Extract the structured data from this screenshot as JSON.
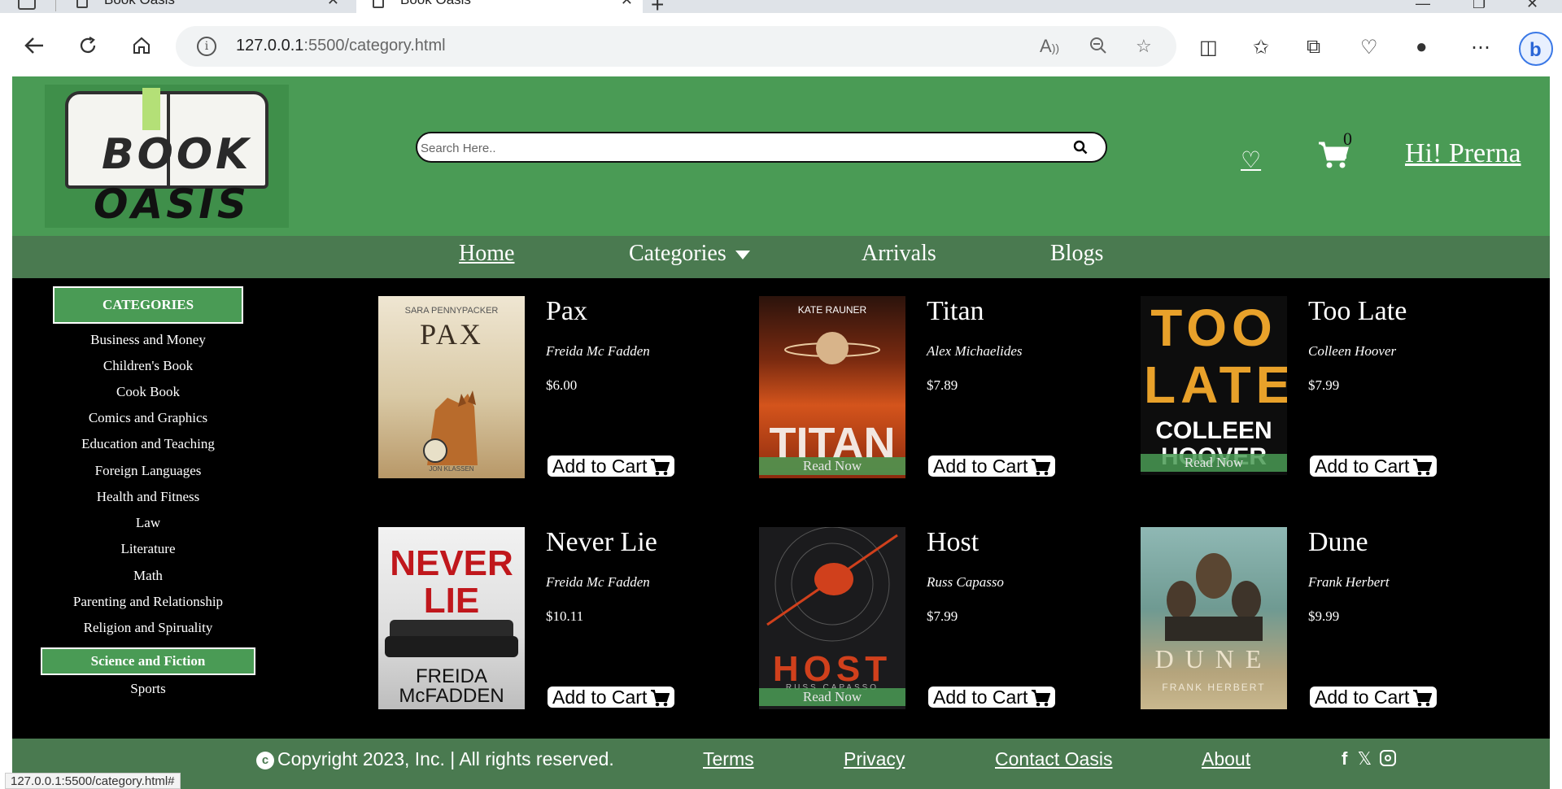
{
  "browser": {
    "tabs": [
      {
        "title": "Book Oasis",
        "active": false
      },
      {
        "title": "Book Oasis",
        "active": true
      }
    ],
    "url_host": "127.0.0.1",
    "url_path": ":5500/category.html",
    "status_url": "127.0.0.1:5500/category.html#"
  },
  "header": {
    "logo_line1": "BOOK",
    "logo_line2": "OASIS",
    "search_placeholder": "Search Here..",
    "cart_count": "0",
    "greeting": "Hi! Prerna"
  },
  "nav": {
    "home": "Home",
    "categories": "Categories",
    "arrivals": "Arrivals",
    "blogs": "Blogs"
  },
  "sidebar": {
    "heading": "CATEGORIES",
    "items": [
      "Business and Money",
      "Children's Book",
      "Cook Book",
      "Comics and Graphics",
      "Education and Teaching",
      "Foreign Languages",
      "Health and Fitness",
      "Law",
      "Literature",
      "Math",
      "Parenting and Relationship",
      "Religion and Spiruality",
      "Science and Fiction",
      "Sports"
    ],
    "active_item": "Science and Fiction"
  },
  "books": [
    {
      "title": "Pax",
      "author": "Freida Mc Fadden",
      "price": "$6.00",
      "cover_text": "PAX",
      "cover_top": "SARA PENNYPACKER",
      "cover_bottom": "JON KLASSEN",
      "read_now": ""
    },
    {
      "title": "Titan",
      "author": "Alex Michaelides",
      "price": "$7.89",
      "cover_text": "TITAN",
      "cover_top": "KATE RAUNER",
      "cover_bottom": "",
      "read_now": "Read Now"
    },
    {
      "title": "Too Late",
      "author": "Colleen Hoover",
      "price": "$7.99",
      "cover_text": "TOO LATE",
      "cover_top": "",
      "cover_bottom": "COLLEEN HOOVER",
      "read_now": "Read Now"
    },
    {
      "title": "Never Lie",
      "author": "Freida Mc Fadden",
      "price": "$10.11",
      "cover_text": "NEVER LIE",
      "cover_top": "",
      "cover_bottom": "FREIDA McFADDEN",
      "read_now": ""
    },
    {
      "title": "Host",
      "author": "Russ Capasso",
      "price": "$7.99",
      "cover_text": "HOST",
      "cover_top": "",
      "cover_bottom": "RUSS CAPASSO",
      "read_now": "Read Now"
    },
    {
      "title": "Dune",
      "author": "Frank Herbert",
      "price": "$9.99",
      "cover_text": "DUNE",
      "cover_top": "",
      "cover_bottom": "FRANK HERBERT",
      "read_now": ""
    }
  ],
  "add_to_cart_label": "Add to Cart",
  "footer": {
    "copyright": "Copyright 2023, Inc. | All rights reserved.",
    "links": [
      "Terms",
      "Privacy",
      "Contact Oasis",
      "About"
    ],
    "social": [
      "facebook-icon",
      "x-icon",
      "instagram-icon"
    ]
  },
  "colors": {
    "header_green": "#4a9b55",
    "nav_green": "#4a7a50",
    "content_bg": "#000000"
  }
}
